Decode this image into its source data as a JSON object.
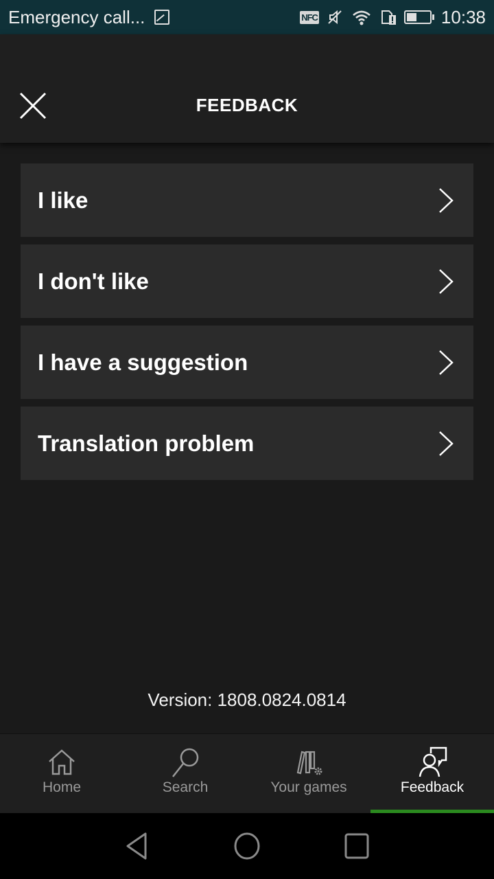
{
  "status_bar": {
    "notification_text": "Emergency call...",
    "nfc_label": "NFC",
    "time": "10:38",
    "battery_level_percent": 40
  },
  "header": {
    "title": "FEEDBACK",
    "close_icon": "close-icon"
  },
  "feedback_options": [
    {
      "label": "I like",
      "icon": "chevron-right-icon"
    },
    {
      "label": "I don't like",
      "icon": "chevron-right-icon"
    },
    {
      "label": "I have a suggestion",
      "icon": "chevron-right-icon"
    },
    {
      "label": "Translation problem",
      "icon": "chevron-right-icon"
    }
  ],
  "version_text": "Version: 1808.0824.0814",
  "tab_bar": {
    "tabs": [
      {
        "label": "Home",
        "icon": "home-icon",
        "active": false
      },
      {
        "label": "Search",
        "icon": "search-icon",
        "active": false
      },
      {
        "label": "Your games",
        "icon": "your-games-icon",
        "active": false
      },
      {
        "label": "Feedback",
        "icon": "feedback-icon",
        "active": true
      }
    ],
    "active_color": "#2b8a1f"
  },
  "nav_bar": {
    "buttons": [
      "back",
      "home",
      "recents"
    ]
  }
}
